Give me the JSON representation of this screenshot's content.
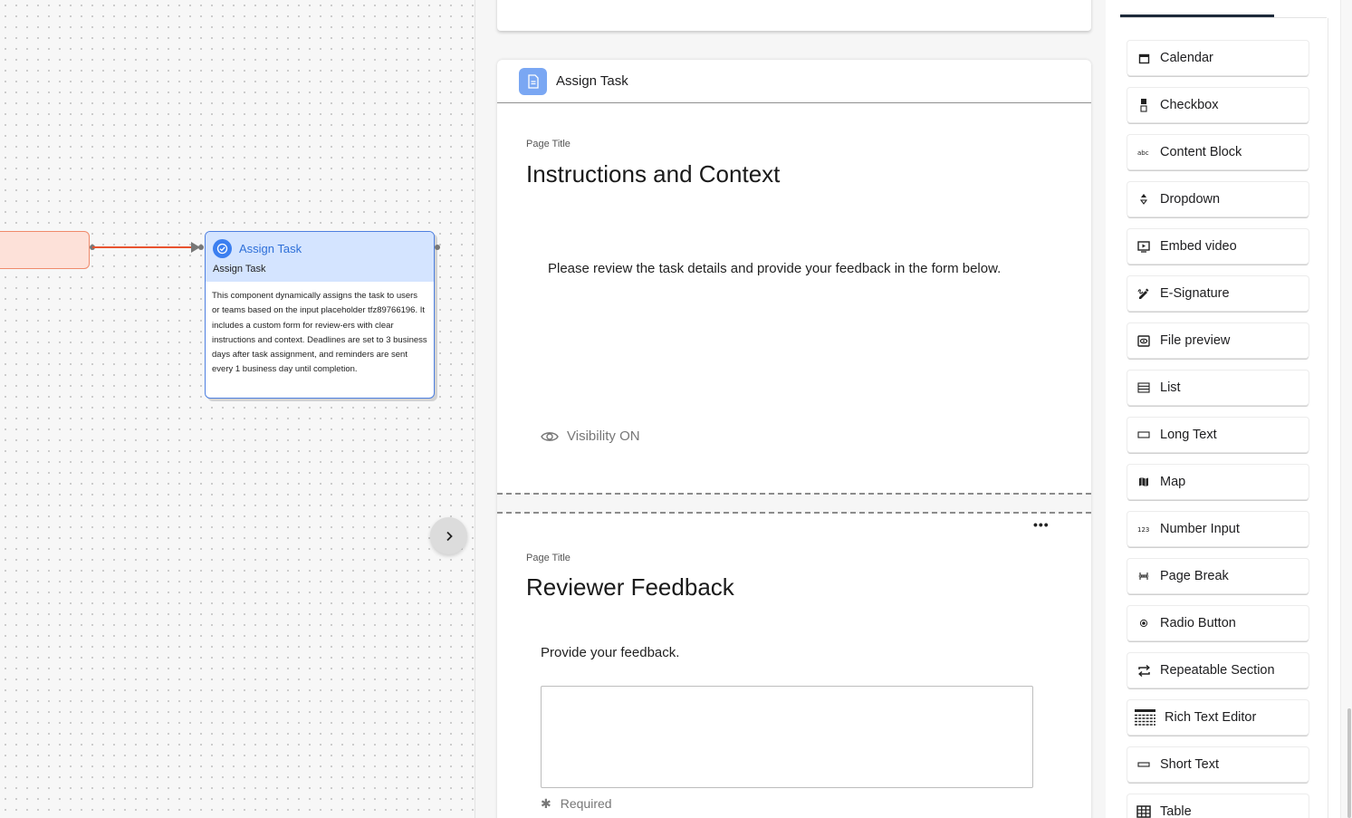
{
  "canvas": {
    "node": {
      "title": "Assign Task",
      "subtitle": "Assign Task",
      "description": "This component dynamically assigns the task to users or teams based on the input placeholder tfz89766196. It includes a custom form for review-ers with clear instructions and context. Deadlines are set to 3 business days after task assignment, and reminders are sent every 1 business day until completion."
    },
    "colors": {
      "edge": "#e8532f",
      "node_border": "#4d7fe0",
      "node_header": "#d4e4ff",
      "prev_node": "#fde1d9"
    }
  },
  "form": {
    "header_title": "Assign Task",
    "page1": {
      "label": "Page Title",
      "title": "Instructions and Context",
      "text": "Please review the task details and provide your feedback in the form below.",
      "visibility": "Visibility ON"
    },
    "page2": {
      "label": "Page Title",
      "title": "Reviewer Feedback",
      "question": "Provide your feedback.",
      "required_mark": "✱",
      "required": "Required",
      "more": "•••"
    }
  },
  "palette": {
    "items": [
      {
        "label": "Calendar",
        "icon": "calendar-icon"
      },
      {
        "label": "Checkbox",
        "icon": "checkbox-icon"
      },
      {
        "label": "Content Block",
        "icon": "content-block-icon"
      },
      {
        "label": "Dropdown",
        "icon": "dropdown-icon"
      },
      {
        "label": "Embed video",
        "icon": "embed-video-icon"
      },
      {
        "label": "E-Signature",
        "icon": "signature-icon"
      },
      {
        "label": "File preview",
        "icon": "file-preview-icon"
      },
      {
        "label": "List",
        "icon": "list-icon"
      },
      {
        "label": "Long Text",
        "icon": "long-text-icon"
      },
      {
        "label": "Map",
        "icon": "map-icon"
      },
      {
        "label": "Number Input",
        "icon": "number-input-icon"
      },
      {
        "label": "Page Break",
        "icon": "page-break-icon"
      },
      {
        "label": "Radio Button",
        "icon": "radio-button-icon"
      },
      {
        "label": "Repeatable Section",
        "icon": "repeat-icon"
      },
      {
        "label": "Rich Text Editor",
        "icon": "rich-text-icon"
      },
      {
        "label": "Short Text",
        "icon": "short-text-icon"
      },
      {
        "label": "Table",
        "icon": "table-icon"
      }
    ]
  }
}
